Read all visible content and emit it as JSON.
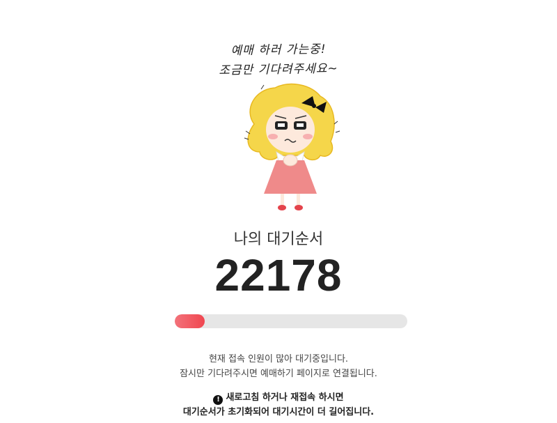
{
  "headline": {
    "line1": "예매 하러 가는중!",
    "line2": "조금만 기다려주세요~"
  },
  "illustration": {
    "icon": "waiting-girl-icon"
  },
  "queue": {
    "label": "나의 대기순서",
    "number": "22178"
  },
  "progress": {
    "fraction": 0.13,
    "colors": {
      "fill": "#f04650",
      "track": "#e6e6e6"
    }
  },
  "info": {
    "line1": "현재 접속 인원이 많아 대기중입니다.",
    "line2": "잠시만 기다려주시면 예매하기 페이지로 연결됩니다."
  },
  "warning": {
    "icon": "exclamation-circle-icon",
    "icon_glyph": "!",
    "line1": "새로고침 하거나 재접속 하시면",
    "line2": "대기순서가 초기화되어 대기시간이 더 길어집니다."
  }
}
